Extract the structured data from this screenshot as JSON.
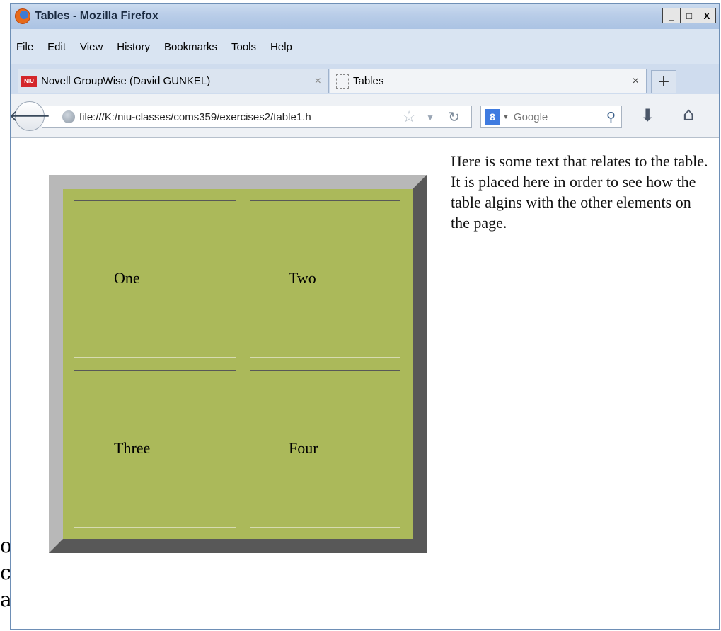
{
  "window": {
    "title": "Tables - Mozilla Firefox",
    "controls": {
      "minimize": "_",
      "maximize": "□",
      "close": "X"
    }
  },
  "menu": {
    "items": [
      "File",
      "Edit",
      "View",
      "History",
      "Bookmarks",
      "Tools",
      "Help"
    ]
  },
  "tabs": [
    {
      "label": "Novell GroupWise (David GUNKEL)",
      "icon": "niu-icon",
      "icon_text": "NIU",
      "active": false,
      "close": "×"
    },
    {
      "label": "Tables",
      "icon": "blank-page-icon",
      "active": true,
      "close": "×"
    }
  ],
  "new_tab_label": "+",
  "nav": {
    "url": "file:///K:/niu-classes/coms359/exercises2/table1.h",
    "search_placeholder": "Google",
    "search_engine_badge": "8"
  },
  "page": {
    "cells": [
      "One",
      "Two",
      "Three",
      "Four"
    ],
    "side_text": "Here is some text that relates to the table. It is placed here in order to see how the table algins with the other elements on the page."
  },
  "backdrop": {
    "edge_letters": [
      "o",
      "c",
      "a"
    ]
  },
  "colors": {
    "table_bg": "#abb95a",
    "table_border_light": "#b8b8b8",
    "table_border_dark": "#585858",
    "titlebar": "#b9cde8"
  }
}
